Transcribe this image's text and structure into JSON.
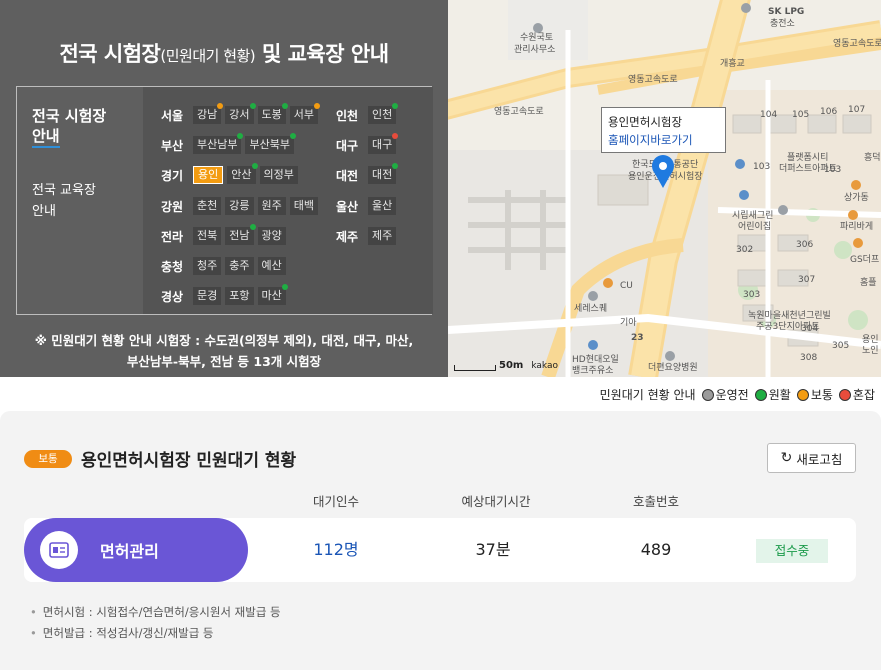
{
  "header": {
    "title_main": "전국 시험장",
    "title_paren": "(민원대기 현황)",
    "title_tail": "및 교육장 안내"
  },
  "menu": {
    "active_line1": "전국 시험장",
    "active_line2": "안내",
    "other_line1": "전국 교육장",
    "other_line2": "안내"
  },
  "regions": [
    {
      "name": "서울",
      "sites": [
        {
          "label": "강남",
          "status": "보통"
        },
        {
          "label": "강서",
          "status": "원활"
        },
        {
          "label": "도봉",
          "status": "원활"
        },
        {
          "label": "서부",
          "status": "보통"
        }
      ]
    },
    {
      "name": "인천",
      "sites": [
        {
          "label": "인천",
          "status": "원활"
        }
      ]
    },
    {
      "name": "부산",
      "sites": [
        {
          "label": "부산남부",
          "status": "원활"
        },
        {
          "label": "부산북부",
          "status": "원활"
        }
      ]
    },
    {
      "name": "대구",
      "sites": [
        {
          "label": "대구",
          "status": "혼잡"
        }
      ]
    },
    {
      "name": "경기",
      "sites": [
        {
          "label": "용인",
          "status": "selected"
        },
        {
          "label": "안산",
          "status": "원활"
        },
        {
          "label": "의정부",
          "status": "none"
        }
      ]
    },
    {
      "name": "대전",
      "sites": [
        {
          "label": "대전",
          "status": "원활"
        }
      ]
    },
    {
      "name": "강원",
      "sites": [
        {
          "label": "춘천",
          "status": "none"
        },
        {
          "label": "강릉",
          "status": "none"
        },
        {
          "label": "원주",
          "status": "none"
        },
        {
          "label": "태백",
          "status": "none"
        }
      ]
    },
    {
      "name": "울산",
      "sites": [
        {
          "label": "울산",
          "status": "none"
        }
      ]
    },
    {
      "name": "전라",
      "sites": [
        {
          "label": "전북",
          "status": "none"
        },
        {
          "label": "전남",
          "status": "원활"
        },
        {
          "label": "광양",
          "status": "none"
        }
      ]
    },
    {
      "name": "제주",
      "sites": [
        {
          "label": "제주",
          "status": "none"
        }
      ]
    },
    {
      "name": "충청",
      "sites": [
        {
          "label": "청주",
          "status": "none"
        },
        {
          "label": "충주",
          "status": "none"
        },
        {
          "label": "예산",
          "status": "none"
        }
      ]
    },
    {
      "name": "경상",
      "sites": [
        {
          "label": "문경",
          "status": "none"
        },
        {
          "label": "포항",
          "status": "none"
        },
        {
          "label": "마산",
          "status": "원활"
        }
      ]
    }
  ],
  "note_line1": "※ 민원대기 현황 안내 시험장 : 수도권(의정부 제외), 대전, 대구, 마산,",
  "note_line2": "부산남부-북부, 전남 등 13개 시험장",
  "map": {
    "popup_title": "용인면허시험장",
    "popup_link": "홈페이지바로가기",
    "labels": [
      "수원국토",
      "관리사무소",
      "SK LPG",
      "충전소",
      "영동고속도로",
      "개흥교",
      "영동고속도로",
      "영동고속도로",
      "한국도로교통공단",
      "용인운전면허시험장",
      "104",
      "105",
      "106",
      "107",
      "103",
      "103",
      "플랫폼시티",
      "더퍼스트아파트",
      "상가동",
      "시립새그린",
      "어린이집",
      "파리바게",
      "302",
      "306",
      "GS더프",
      "CU",
      "307",
      "303",
      "세레스퀘",
      "기아",
      "녹원마을새천년그린빌",
      "주공3단지아파트",
      "23",
      "304",
      "HD현대오일",
      "뱅크주유소",
      "더편요양병원",
      "308",
      "305",
      "용인",
      "노인",
      "흥덕",
      "홈플",
      "수원"
    ],
    "scale": "50m",
    "provider": "kakao"
  },
  "legend": {
    "title": "민원대기 현황 안내",
    "items": [
      {
        "label": "운영전",
        "color": "#9b9b9b"
      },
      {
        "label": "원활",
        "color": "#1fae43"
      },
      {
        "label": "보통",
        "color": "#f39c12"
      },
      {
        "label": "혼잡",
        "color": "#e74c3c"
      }
    ]
  },
  "status": {
    "badge": "보통",
    "title": "용인면허시험장 민원대기 현황",
    "refresh": "새로고침",
    "columns": [
      "대기인수",
      "예상대기시간",
      "호출번호"
    ],
    "row": {
      "category": "면허관리",
      "waiting": "112명",
      "expected": "37분",
      "call_no": "489",
      "state": "접수중"
    },
    "notes": [
      "면허시험 : 시험접수/연습면허/응시원서 재발급 등",
      "면허발급 : 적성검사/갱신/재발급 등"
    ]
  }
}
